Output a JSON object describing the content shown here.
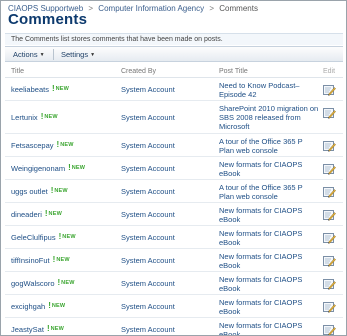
{
  "breadcrumb": {
    "site": "CIAOPS Supportweb",
    "subsite": "Computer Information Agency",
    "current": "Comments",
    "separator": ">"
  },
  "page_title": "Comments",
  "description": "The Comments list stores comments that have been made on posts.",
  "toolbar": {
    "actions_label": "Actions",
    "settings_label": "Settings"
  },
  "columns": {
    "title": "Title",
    "created_by": "Created By",
    "post_title": "Post Title",
    "edit": "Edit"
  },
  "new_label": "NEW",
  "new_mark": "!",
  "accent_color": "#3aa52f",
  "rows": [
    {
      "title": "keeliabeats",
      "created_by": "System Account",
      "post_title": "Need to Know Podcast– Episode 42",
      "is_new": true
    },
    {
      "title": "Lertunix",
      "created_by": "System Account",
      "post_title": "SharePoint 2010 migration on SBS 2008 released from Microsoft",
      "is_new": true
    },
    {
      "title": "Fetsascepay",
      "created_by": "System Account",
      "post_title": "A tour of the Office 365 P Plan web console",
      "is_new": true
    },
    {
      "title": "Weingigenonam",
      "created_by": "System Account",
      "post_title": "New formats for CIAOPS eBook",
      "is_new": true
    },
    {
      "title": "uggs outlet",
      "created_by": "System Account",
      "post_title": "A tour of the Office 365 P Plan web console",
      "is_new": true
    },
    {
      "title": "dineaderi",
      "created_by": "System Account",
      "post_title": "New formats for CIAOPS eBook",
      "is_new": true
    },
    {
      "title": "GeleClulfipus",
      "created_by": "System Account",
      "post_title": "New formats for CIAOPS eBook",
      "is_new": true
    },
    {
      "title": "tiffInsinoFut",
      "created_by": "System Account",
      "post_title": "New formats for CIAOPS eBook",
      "is_new": true
    },
    {
      "title": "gogWalscoro",
      "created_by": "System Account",
      "post_title": "New formats for CIAOPS eBook",
      "is_new": true
    },
    {
      "title": "excighgah",
      "created_by": "System Account",
      "post_title": "New formats for CIAOPS eBook",
      "is_new": true
    },
    {
      "title": "JeastySat",
      "created_by": "System Account",
      "post_title": "New formats for CIAOPS eBook",
      "is_new": true
    }
  ]
}
